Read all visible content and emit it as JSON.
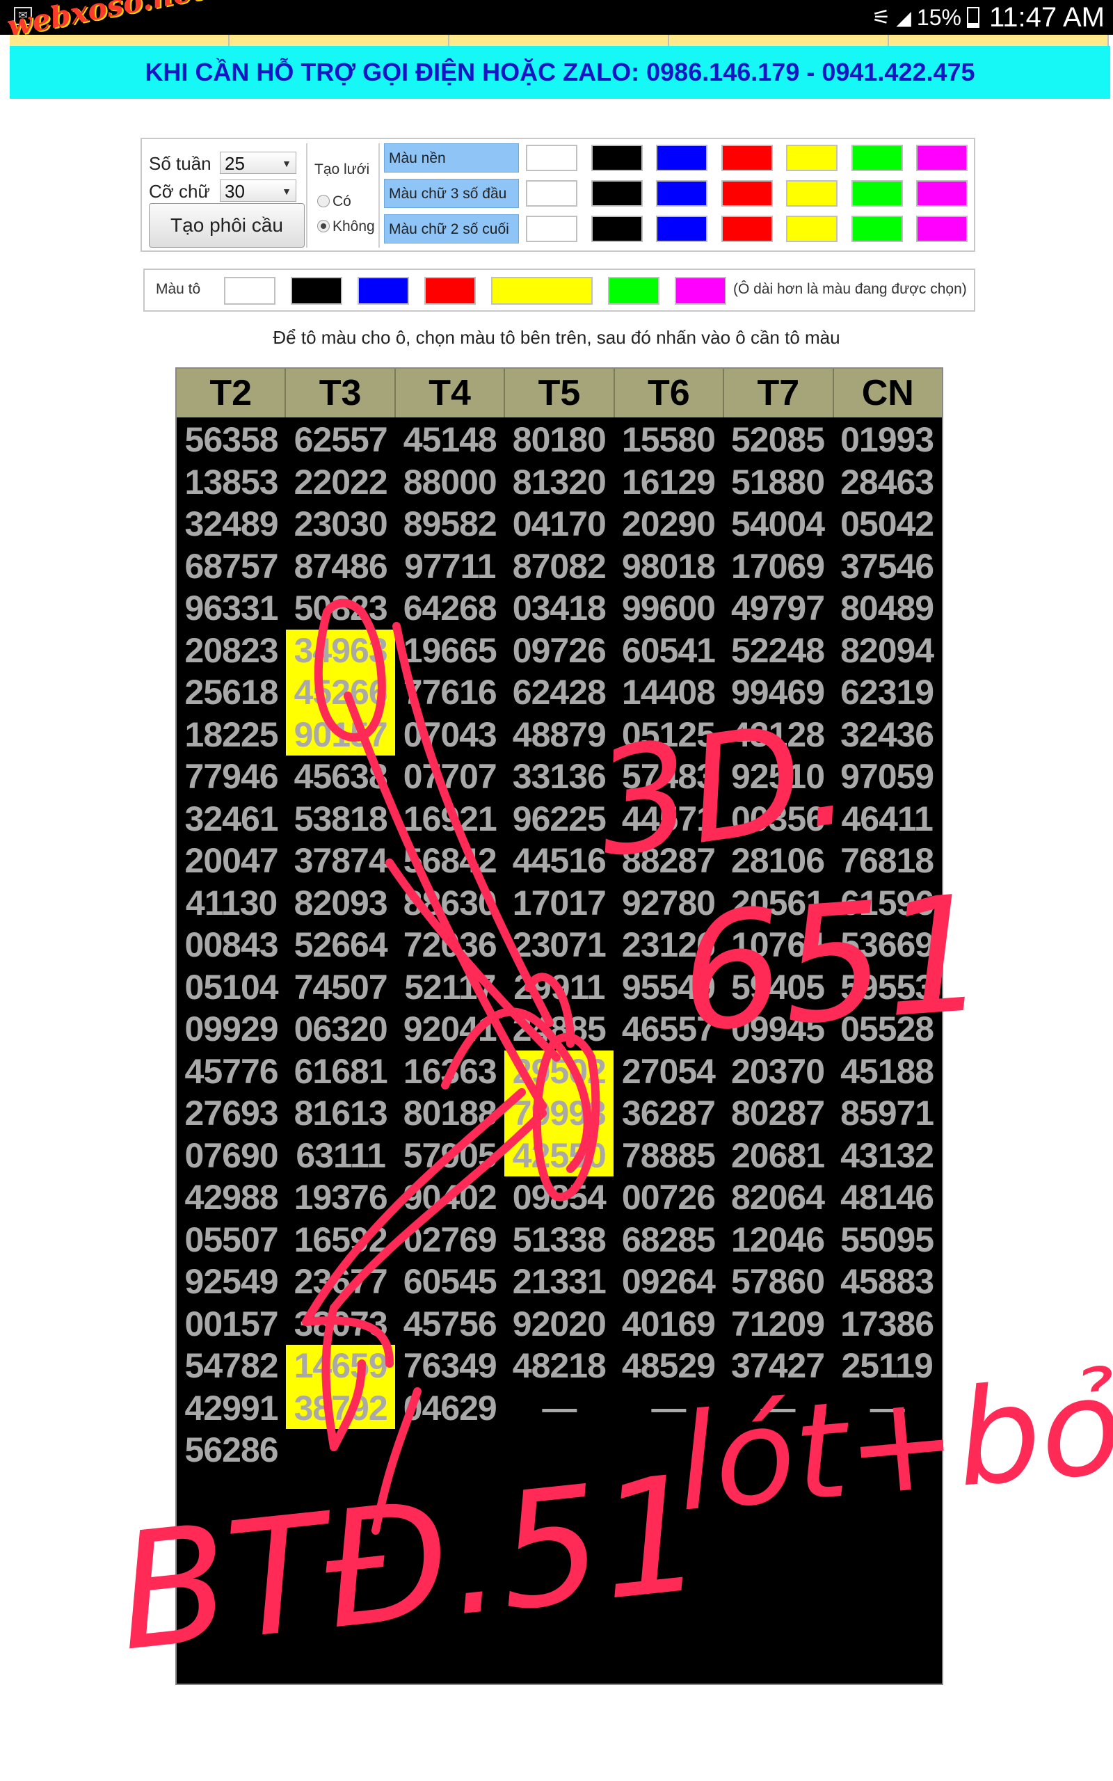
{
  "status_bar": {
    "watermark": "webxoso.net",
    "battery": "15%",
    "time": "11:47 AM"
  },
  "top_nav": [
    "",
    "",
    "",
    "",
    ""
  ],
  "banner": {
    "text": "KHI CẦN HỖ TRỢ GỌI ĐIỆN HOẶC ZALO: 0986.146.179 - 0941.422.475",
    "background": "#16f8f6",
    "color": "#1515c4"
  },
  "controls": {
    "weeks_label": "Số tuần",
    "weeks_value": "25",
    "font_size_label": "Cỡ chữ",
    "font_size_value": "30",
    "create_button": "Tạo phôi cầu",
    "grid_label": "Tạo lưới",
    "grid_yes": "Có",
    "grid_no": "Không",
    "grid_selected": "Không",
    "color_rows": [
      "Màu nền",
      "Màu chữ 3 số đầu",
      "Màu chữ 2 số cuối"
    ],
    "palette": [
      "#ffffff",
      "#000000",
      "#0000ff",
      "#ff0000",
      "#ffff00",
      "#00ff00",
      "#ff00ff"
    ],
    "fill_label": "Màu tô",
    "fill_hint": "(Ô dài hơn là màu đang được chọn)",
    "fill_selected": "#ffff00"
  },
  "instruction": "Để tô màu cho ô, chọn màu tô bên trên, sau đó nhấn vào ô cần tô màu",
  "table": {
    "headers": [
      "T2",
      "T3",
      "T4",
      "T5",
      "T6",
      "T7",
      "CN"
    ],
    "rows": [
      [
        "56358",
        "62557",
        "45148",
        "80180",
        "15580",
        "52085",
        "01993"
      ],
      [
        "13853",
        "22022",
        "88000",
        "81320",
        "16129",
        "51880",
        "28463"
      ],
      [
        "32489",
        "23030",
        "89582",
        "04170",
        "20290",
        "54004",
        "05042"
      ],
      [
        "68757",
        "87486",
        "97711",
        "87082",
        "98018",
        "17069",
        "37546"
      ],
      [
        "96331",
        "50823",
        "64268",
        "03418",
        "99600",
        "49797",
        "80489"
      ],
      [
        "20823",
        "34963",
        "19665",
        "09726",
        "60541",
        "52248",
        "82094"
      ],
      [
        "25618",
        "45266",
        "77616",
        "62428",
        "14408",
        "99469",
        "62319"
      ],
      [
        "18225",
        "90157",
        "07043",
        "48879",
        "05125",
        "43128",
        "32436"
      ],
      [
        "77946",
        "45638",
        "07707",
        "33136",
        "57483",
        "92510",
        "97059"
      ],
      [
        "32461",
        "53818",
        "16921",
        "96225",
        "44571",
        "00356",
        "46411"
      ],
      [
        "20047",
        "37874",
        "56842",
        "44516",
        "88287",
        "28106",
        "76818"
      ],
      [
        "41130",
        "82093",
        "88630",
        "17017",
        "92780",
        "20561",
        "61596"
      ],
      [
        "00843",
        "52664",
        "72036",
        "23071",
        "23126",
        "10764",
        "53669"
      ],
      [
        "05104",
        "74507",
        "52117",
        "29911",
        "95549",
        "59405",
        "59553"
      ],
      [
        "09929",
        "06320",
        "92041",
        "24885",
        "46557",
        "09945",
        "05528"
      ],
      [
        "45776",
        "61681",
        "16363",
        "29502",
        "27054",
        "20370",
        "45188"
      ],
      [
        "27693",
        "81613",
        "80188",
        "79993",
        "36287",
        "80287",
        "85971"
      ],
      [
        "07690",
        "63111",
        "57905",
        "42550",
        "78885",
        "20681",
        "43132"
      ],
      [
        "42988",
        "19376",
        "90402",
        "09854",
        "00726",
        "82064",
        "48146"
      ],
      [
        "05507",
        "16592",
        "02769",
        "51338",
        "68285",
        "12046",
        "55095"
      ],
      [
        "92549",
        "23677",
        "60545",
        "21331",
        "09264",
        "57860",
        "45883"
      ],
      [
        "00157",
        "38073",
        "45756",
        "92020",
        "40169",
        "71209",
        "17386"
      ],
      [
        "54782",
        "14659",
        "76349",
        "48218",
        "48529",
        "37427",
        "25119"
      ],
      [
        "42991",
        "38792",
        "04629",
        "—",
        "—",
        "—",
        "—"
      ],
      [
        "56286",
        "",
        "",
        "",
        "",
        "",
        ""
      ]
    ],
    "highlighted": [
      [
        5,
        1
      ],
      [
        6,
        1
      ],
      [
        7,
        1
      ],
      [
        15,
        3
      ],
      [
        16,
        3
      ],
      [
        17,
        3
      ],
      [
        22,
        1
      ],
      [
        23,
        1
      ]
    ]
  },
  "handwriting": {
    "color": "#ff2a55",
    "notes": [
      "3D.",
      "651",
      "BTĐ.51",
      "lót+bỏ"
    ]
  }
}
